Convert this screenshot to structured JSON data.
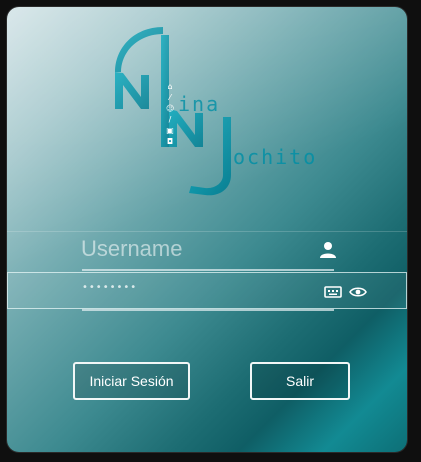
{
  "logo": {
    "word_top": "ina",
    "word_bottom": "ochito",
    "small_icons": [
      "home-icon",
      "wand-icon",
      "users-icon",
      "pen-icon",
      "image-icon",
      "car-icon"
    ]
  },
  "login": {
    "username_placeholder": "Username",
    "username_value": "",
    "password_value": "••••••••",
    "user_icon": "user-icon",
    "keyboard_icon": "keyboard-icon",
    "show_password_icon": "eye-icon"
  },
  "buttons": {
    "login_label": "Iniciar Sesión",
    "exit_label": "Salir"
  },
  "colors": {
    "accent": "#0b8fa3",
    "button_border": "#f2f7f7"
  }
}
